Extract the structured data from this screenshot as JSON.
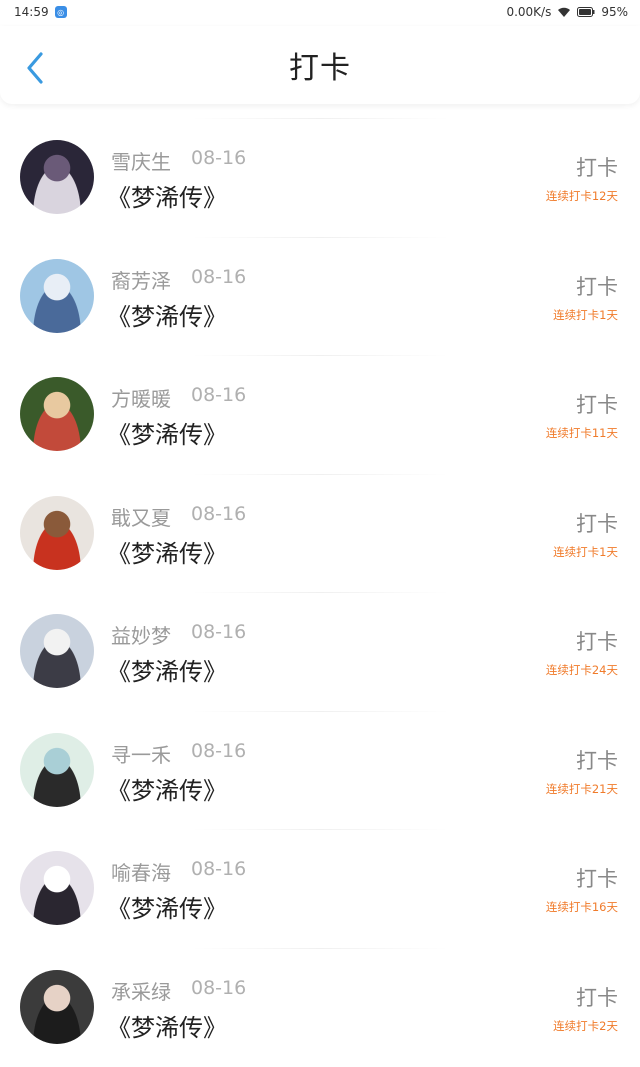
{
  "status_bar": {
    "time": "14:59",
    "net_speed": "0.00K/s",
    "battery": "95%"
  },
  "header": {
    "title": "打卡"
  },
  "entries": [
    {
      "name": "雪庆生",
      "date": "08-16",
      "book": "《梦浠传》",
      "action": "打卡",
      "streak": "连续打卡12天",
      "avatar_colors": [
        "#2a2638",
        "#6a5a78",
        "#d9d4de"
      ]
    },
    {
      "name": "裔芳泽",
      "date": "08-16",
      "book": "《梦浠传》",
      "action": "打卡",
      "streak": "连续打卡1天",
      "avatar_colors": [
        "#9fc6e4",
        "#e8eef6",
        "#4a6a9a"
      ]
    },
    {
      "name": "方暖暖",
      "date": "08-16",
      "book": "《梦浠传》",
      "action": "打卡",
      "streak": "连续打卡11天",
      "avatar_colors": [
        "#3a5a2a",
        "#e8c9a0",
        "#c24a3a"
      ]
    },
    {
      "name": "戢又夏",
      "date": "08-16",
      "book": "《梦浠传》",
      "action": "打卡",
      "streak": "连续打卡1天",
      "avatar_colors": [
        "#e9e4df",
        "#8a5a3a",
        "#c8321f"
      ]
    },
    {
      "name": "益妙梦",
      "date": "08-16",
      "book": "《梦浠传》",
      "action": "打卡",
      "streak": "连续打卡24天",
      "avatar_colors": [
        "#c9d2de",
        "#f2f2f2",
        "#3c3c46"
      ]
    },
    {
      "name": "寻一禾",
      "date": "08-16",
      "book": "《梦浠传》",
      "action": "打卡",
      "streak": "连续打卡21天",
      "avatar_colors": [
        "#dfeee6",
        "#a9cfd6",
        "#2a2a2a"
      ]
    },
    {
      "name": "喻春海",
      "date": "08-16",
      "book": "《梦浠传》",
      "action": "打卡",
      "streak": "连续打卡16天",
      "avatar_colors": [
        "#e6e2ea",
        "#ffffff",
        "#2a2630"
      ]
    },
    {
      "name": "承采绿",
      "date": "08-16",
      "book": "《梦浠传》",
      "action": "打卡",
      "streak": "连续打卡2天",
      "avatar_colors": [
        "#3b3b3b",
        "#e6d2c6",
        "#1c1c1c"
      ]
    }
  ]
}
